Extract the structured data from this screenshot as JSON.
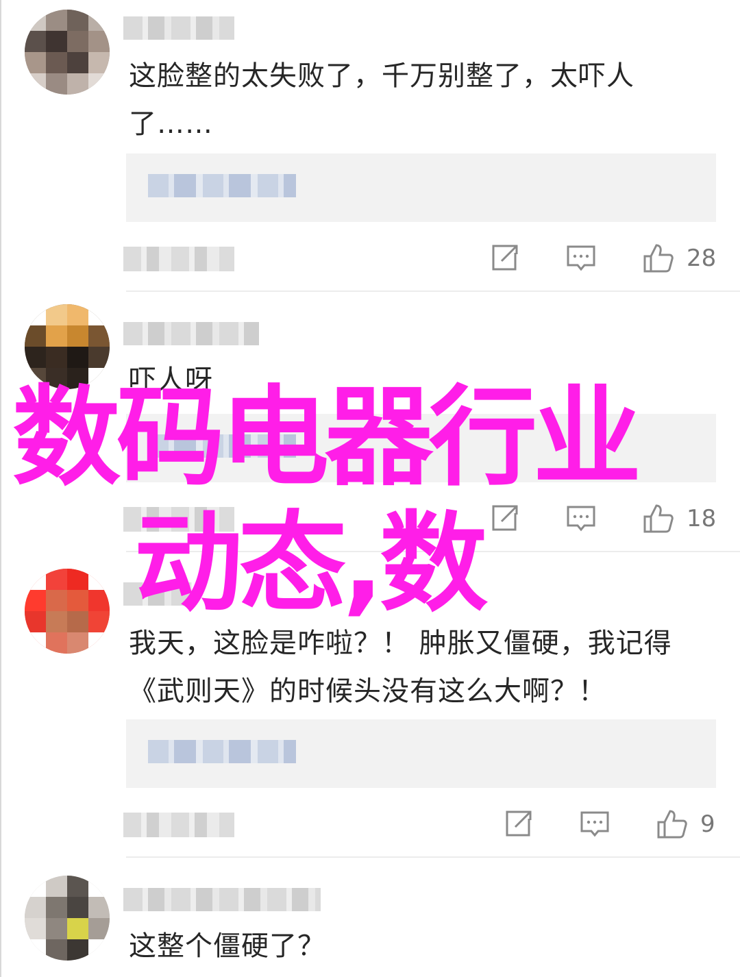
{
  "comments": [
    {
      "text_lines": [
        "这脸整的太失败了，千万别整了，太吓人",
        "了……"
      ],
      "like_count": "28"
    },
    {
      "text_lines": [
        "吓人呀"
      ],
      "like_count": "18"
    },
    {
      "text_lines": [
        "我天，这脸是咋啦？！ 肿胀又僵硬，我记得",
        "《武则天》的时候头没有这么大啊？！"
      ],
      "like_count": "9"
    },
    {
      "text_lines": [
        "这整个僵硬了？"
      ],
      "like_count": ""
    }
  ],
  "overlay": {
    "line1": "数码电器行业",
    "line2": "动态,数"
  },
  "colors": {
    "overlay_text": "#ff1ee8",
    "icon_gray": "#8a8a8a"
  },
  "icons": {
    "share": "share-icon",
    "reply": "comment-icon",
    "like": "thumbs-up-icon"
  }
}
